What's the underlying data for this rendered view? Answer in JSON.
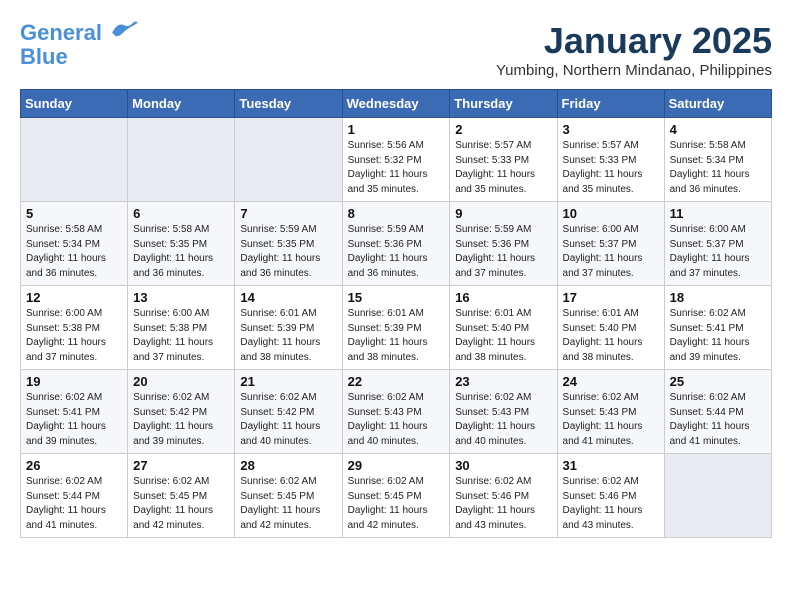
{
  "logo": {
    "line1": "General",
    "line2": "Blue"
  },
  "title": "January 2025",
  "subtitle": "Yumbing, Northern Mindanao, Philippines",
  "weekdays": [
    "Sunday",
    "Monday",
    "Tuesday",
    "Wednesday",
    "Thursday",
    "Friday",
    "Saturday"
  ],
  "weeks": [
    [
      {
        "day": "",
        "info": ""
      },
      {
        "day": "",
        "info": ""
      },
      {
        "day": "",
        "info": ""
      },
      {
        "day": "1",
        "info": "Sunrise: 5:56 AM\nSunset: 5:32 PM\nDaylight: 11 hours and 35 minutes."
      },
      {
        "day": "2",
        "info": "Sunrise: 5:57 AM\nSunset: 5:33 PM\nDaylight: 11 hours and 35 minutes."
      },
      {
        "day": "3",
        "info": "Sunrise: 5:57 AM\nSunset: 5:33 PM\nDaylight: 11 hours and 35 minutes."
      },
      {
        "day": "4",
        "info": "Sunrise: 5:58 AM\nSunset: 5:34 PM\nDaylight: 11 hours and 36 minutes."
      }
    ],
    [
      {
        "day": "5",
        "info": "Sunrise: 5:58 AM\nSunset: 5:34 PM\nDaylight: 11 hours and 36 minutes."
      },
      {
        "day": "6",
        "info": "Sunrise: 5:58 AM\nSunset: 5:35 PM\nDaylight: 11 hours and 36 minutes."
      },
      {
        "day": "7",
        "info": "Sunrise: 5:59 AM\nSunset: 5:35 PM\nDaylight: 11 hours and 36 minutes."
      },
      {
        "day": "8",
        "info": "Sunrise: 5:59 AM\nSunset: 5:36 PM\nDaylight: 11 hours and 36 minutes."
      },
      {
        "day": "9",
        "info": "Sunrise: 5:59 AM\nSunset: 5:36 PM\nDaylight: 11 hours and 37 minutes."
      },
      {
        "day": "10",
        "info": "Sunrise: 6:00 AM\nSunset: 5:37 PM\nDaylight: 11 hours and 37 minutes."
      },
      {
        "day": "11",
        "info": "Sunrise: 6:00 AM\nSunset: 5:37 PM\nDaylight: 11 hours and 37 minutes."
      }
    ],
    [
      {
        "day": "12",
        "info": "Sunrise: 6:00 AM\nSunset: 5:38 PM\nDaylight: 11 hours and 37 minutes."
      },
      {
        "day": "13",
        "info": "Sunrise: 6:00 AM\nSunset: 5:38 PM\nDaylight: 11 hours and 37 minutes."
      },
      {
        "day": "14",
        "info": "Sunrise: 6:01 AM\nSunset: 5:39 PM\nDaylight: 11 hours and 38 minutes."
      },
      {
        "day": "15",
        "info": "Sunrise: 6:01 AM\nSunset: 5:39 PM\nDaylight: 11 hours and 38 minutes."
      },
      {
        "day": "16",
        "info": "Sunrise: 6:01 AM\nSunset: 5:40 PM\nDaylight: 11 hours and 38 minutes."
      },
      {
        "day": "17",
        "info": "Sunrise: 6:01 AM\nSunset: 5:40 PM\nDaylight: 11 hours and 38 minutes."
      },
      {
        "day": "18",
        "info": "Sunrise: 6:02 AM\nSunset: 5:41 PM\nDaylight: 11 hours and 39 minutes."
      }
    ],
    [
      {
        "day": "19",
        "info": "Sunrise: 6:02 AM\nSunset: 5:41 PM\nDaylight: 11 hours and 39 minutes."
      },
      {
        "day": "20",
        "info": "Sunrise: 6:02 AM\nSunset: 5:42 PM\nDaylight: 11 hours and 39 minutes."
      },
      {
        "day": "21",
        "info": "Sunrise: 6:02 AM\nSunset: 5:42 PM\nDaylight: 11 hours and 40 minutes."
      },
      {
        "day": "22",
        "info": "Sunrise: 6:02 AM\nSunset: 5:43 PM\nDaylight: 11 hours and 40 minutes."
      },
      {
        "day": "23",
        "info": "Sunrise: 6:02 AM\nSunset: 5:43 PM\nDaylight: 11 hours and 40 minutes."
      },
      {
        "day": "24",
        "info": "Sunrise: 6:02 AM\nSunset: 5:43 PM\nDaylight: 11 hours and 41 minutes."
      },
      {
        "day": "25",
        "info": "Sunrise: 6:02 AM\nSunset: 5:44 PM\nDaylight: 11 hours and 41 minutes."
      }
    ],
    [
      {
        "day": "26",
        "info": "Sunrise: 6:02 AM\nSunset: 5:44 PM\nDaylight: 11 hours and 41 minutes."
      },
      {
        "day": "27",
        "info": "Sunrise: 6:02 AM\nSunset: 5:45 PM\nDaylight: 11 hours and 42 minutes."
      },
      {
        "day": "28",
        "info": "Sunrise: 6:02 AM\nSunset: 5:45 PM\nDaylight: 11 hours and 42 minutes."
      },
      {
        "day": "29",
        "info": "Sunrise: 6:02 AM\nSunset: 5:45 PM\nDaylight: 11 hours and 42 minutes."
      },
      {
        "day": "30",
        "info": "Sunrise: 6:02 AM\nSunset: 5:46 PM\nDaylight: 11 hours and 43 minutes."
      },
      {
        "day": "31",
        "info": "Sunrise: 6:02 AM\nSunset: 5:46 PM\nDaylight: 11 hours and 43 minutes."
      },
      {
        "day": "",
        "info": ""
      }
    ]
  ]
}
